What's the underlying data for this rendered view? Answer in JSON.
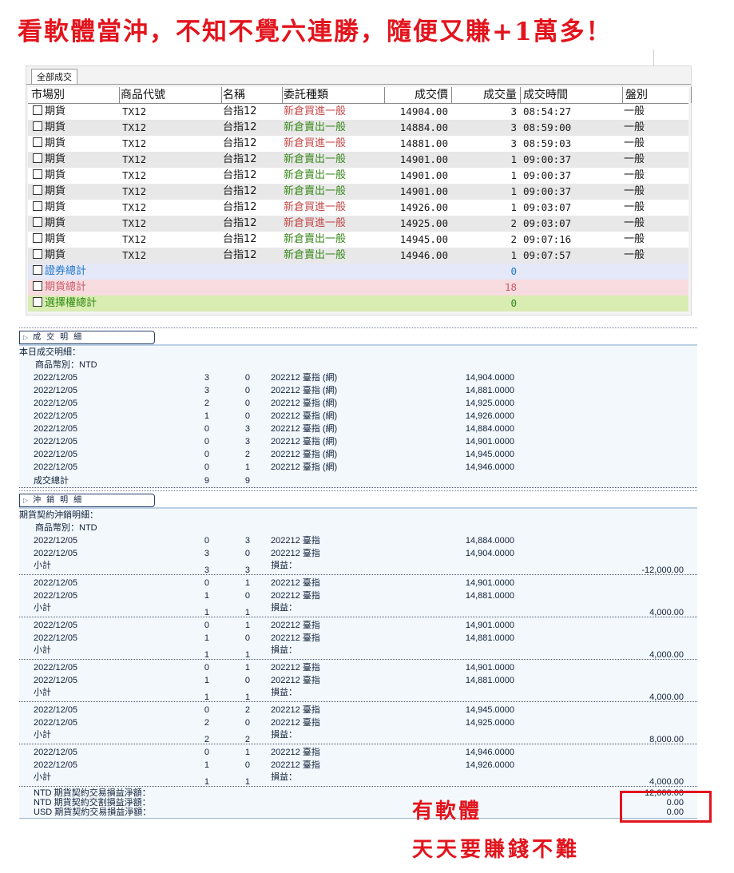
{
  "headline": "看軟體當沖，不知不覺六連勝，隨便又賺+1萬多！",
  "grid": {
    "tab_label": "全部成交",
    "columns": [
      "市場別",
      "商品代號",
      "名稱",
      "委託種類",
      "成交價",
      "成交量",
      "成交時間",
      "盤別"
    ],
    "rows": [
      {
        "market": "期貨",
        "code": "TX12",
        "name": "台指12",
        "type": "新倉買進一般",
        "side": "buy",
        "price": "14904.00",
        "qty": "3",
        "time": "08:54:27",
        "session": "一般"
      },
      {
        "market": "期貨",
        "code": "TX12",
        "name": "台指12",
        "type": "新倉賣出一般",
        "side": "sell",
        "price": "14884.00",
        "qty": "3",
        "time": "08:59:00",
        "session": "一般"
      },
      {
        "market": "期貨",
        "code": "TX12",
        "name": "台指12",
        "type": "新倉買進一般",
        "side": "buy",
        "price": "14881.00",
        "qty": "3",
        "time": "08:59:03",
        "session": "一般"
      },
      {
        "market": "期貨",
        "code": "TX12",
        "name": "台指12",
        "type": "新倉賣出一般",
        "side": "sell",
        "price": "14901.00",
        "qty": "1",
        "time": "09:00:37",
        "session": "一般"
      },
      {
        "market": "期貨",
        "code": "TX12",
        "name": "台指12",
        "type": "新倉賣出一般",
        "side": "sell",
        "price": "14901.00",
        "qty": "1",
        "time": "09:00:37",
        "session": "一般"
      },
      {
        "market": "期貨",
        "code": "TX12",
        "name": "台指12",
        "type": "新倉賣出一般",
        "side": "sell",
        "price": "14901.00",
        "qty": "1",
        "time": "09:00:37",
        "session": "一般"
      },
      {
        "market": "期貨",
        "code": "TX12",
        "name": "台指12",
        "type": "新倉買進一般",
        "side": "buy",
        "price": "14926.00",
        "qty": "1",
        "time": "09:03:07",
        "session": "一般"
      },
      {
        "market": "期貨",
        "code": "TX12",
        "name": "台指12",
        "type": "新倉買進一般",
        "side": "buy",
        "price": "14925.00",
        "qty": "2",
        "time": "09:03:07",
        "session": "一般"
      },
      {
        "market": "期貨",
        "code": "TX12",
        "name": "台指12",
        "type": "新倉賣出一般",
        "side": "sell",
        "price": "14945.00",
        "qty": "2",
        "time": "09:07:16",
        "session": "一般"
      },
      {
        "market": "期貨",
        "code": "TX12",
        "name": "台指12",
        "type": "新倉賣出一般",
        "side": "sell",
        "price": "14946.00",
        "qty": "1",
        "time": "09:07:57",
        "session": "一般"
      }
    ],
    "totals": [
      {
        "label": "證券總計",
        "qty": "0",
        "kind": "sec"
      },
      {
        "label": "期貨總計",
        "qty": "18",
        "kind": "fut"
      },
      {
        "label": "選擇權總計",
        "qty": "0",
        "kind": "opt"
      }
    ]
  },
  "trade_detail": {
    "section_tab": "成交明細",
    "title": "本日成交明細：",
    "currency": "商品幣別：NTD",
    "rows": [
      {
        "date": "2022/12/05",
        "buy": "3",
        "sell": "0",
        "name": "202212 臺指 (網)",
        "price": "14,904.0000"
      },
      {
        "date": "2022/12/05",
        "buy": "3",
        "sell": "0",
        "name": "202212 臺指 (網)",
        "price": "14,881.0000"
      },
      {
        "date": "2022/12/05",
        "buy": "2",
        "sell": "0",
        "name": "202212 臺指 (網)",
        "price": "14,925.0000"
      },
      {
        "date": "2022/12/05",
        "buy": "1",
        "sell": "0",
        "name": "202212 臺指 (網)",
        "price": "14,926.0000"
      },
      {
        "date": "2022/12/05",
        "buy": "0",
        "sell": "3",
        "name": "202212 臺指 (網)",
        "price": "14,884.0000"
      },
      {
        "date": "2022/12/05",
        "buy": "0",
        "sell": "3",
        "name": "202212 臺指 (網)",
        "price": "14,901.0000"
      },
      {
        "date": "2022/12/05",
        "buy": "0",
        "sell": "2",
        "name": "202212 臺指 (網)",
        "price": "14,945.0000"
      },
      {
        "date": "2022/12/05",
        "buy": "0",
        "sell": "1",
        "name": "202212 臺指 (網)",
        "price": "14,946.0000"
      }
    ],
    "total": {
      "label": "成交總計",
      "buy": "9",
      "sell": "9"
    }
  },
  "offset_detail": {
    "section_tab": "沖銷明細",
    "title": "期貨契約沖銷明細：",
    "currency": "商品幣別：NTD",
    "subtotal_label": "小計",
    "pl_label": "損益：",
    "groups": [
      {
        "rows": [
          {
            "date": "2022/12/05",
            "buy": "0",
            "sell": "3",
            "name": "202212 臺指",
            "price": "14,884.0000"
          },
          {
            "date": "2022/12/05",
            "buy": "3",
            "sell": "0",
            "name": "202212 臺指",
            "price": "14,904.0000"
          }
        ],
        "sub_buy": "3",
        "sub_sell": "3",
        "pl": "-12,000.00"
      },
      {
        "rows": [
          {
            "date": "2022/12/05",
            "buy": "0",
            "sell": "1",
            "name": "202212 臺指",
            "price": "14,901.0000"
          },
          {
            "date": "2022/12/05",
            "buy": "1",
            "sell": "0",
            "name": "202212 臺指",
            "price": "14,881.0000"
          }
        ],
        "sub_buy": "1",
        "sub_sell": "1",
        "pl": "4,000.00"
      },
      {
        "rows": [
          {
            "date": "2022/12/05",
            "buy": "0",
            "sell": "1",
            "name": "202212 臺指",
            "price": "14,901.0000"
          },
          {
            "date": "2022/12/05",
            "buy": "1",
            "sell": "0",
            "name": "202212 臺指",
            "price": "14,881.0000"
          }
        ],
        "sub_buy": "1",
        "sub_sell": "1",
        "pl": "4,000.00"
      },
      {
        "rows": [
          {
            "date": "2022/12/05",
            "buy": "0",
            "sell": "1",
            "name": "202212 臺指",
            "price": "14,901.0000"
          },
          {
            "date": "2022/12/05",
            "buy": "1",
            "sell": "0",
            "name": "202212 臺指",
            "price": "14,881.0000"
          }
        ],
        "sub_buy": "1",
        "sub_sell": "1",
        "pl": "4,000.00"
      },
      {
        "rows": [
          {
            "date": "2022/12/05",
            "buy": "0",
            "sell": "2",
            "name": "202212 臺指",
            "price": "14,945.0000"
          },
          {
            "date": "2022/12/05",
            "buy": "2",
            "sell": "0",
            "name": "202212 臺指",
            "price": "14,925.0000"
          }
        ],
        "sub_buy": "2",
        "sub_sell": "2",
        "pl": "8,000.00"
      },
      {
        "rows": [
          {
            "date": "2022/12/05",
            "buy": "0",
            "sell": "1",
            "name": "202212 臺指",
            "price": "14,946.0000"
          },
          {
            "date": "2022/12/05",
            "buy": "1",
            "sell": "0",
            "name": "202212 臺指",
            "price": "14,926.0000"
          }
        ],
        "sub_buy": "1",
        "sub_sell": "1",
        "pl": "4,000.00"
      }
    ],
    "summary": [
      {
        "label": "NTD 期貨契約交易損益淨額：",
        "value": "12,000.00"
      },
      {
        "label": "NTD 期貨契約交割損益淨額：",
        "value": "0.00"
      },
      {
        "label": "USD 期貨契約交易損益淨額：",
        "value": "0.00"
      }
    ]
  },
  "annotations": {
    "line1": "有軟體",
    "line2": "天天要賺錢不難"
  },
  "colors": {
    "headline": "#e2141d",
    "buy": "#c44949",
    "sell": "#3c8a1e",
    "highlight_box": "#e2141d"
  }
}
